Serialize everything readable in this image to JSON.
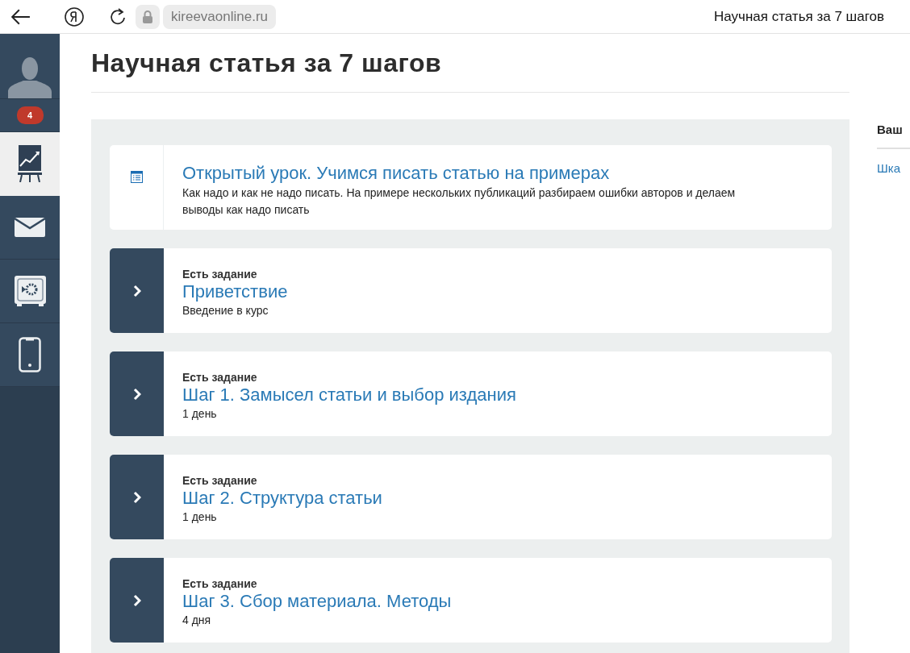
{
  "browser": {
    "address": "kireevaonline.ru",
    "tab_title": "Научная статья за 7 шагов"
  },
  "sidebar": {
    "badge": "4",
    "items": [
      {
        "kind": "chart",
        "selected": true
      },
      {
        "kind": "mail",
        "selected": false
      },
      {
        "kind": "safe",
        "selected": false
      },
      {
        "kind": "phone",
        "selected": false
      }
    ]
  },
  "page": {
    "title": "Научная статья за 7 шагов"
  },
  "lessons": [
    {
      "kind": "open",
      "title": "Открытый урок. Учимся писать статью на примерах",
      "description": "Как надо и как не надо писать. На примере нескольких публикаций разбираем ошибки авторов и делаем выводы как надо писать"
    },
    {
      "kind": "task",
      "task_label": "Есть задание",
      "title": "Приветствие",
      "description": "Введение в курс"
    },
    {
      "kind": "task",
      "task_label": "Есть задание",
      "title": "Шаг 1. Замысел статьи и выбор издания",
      "description": "1 день"
    },
    {
      "kind": "task",
      "task_label": "Есть задание",
      "title": "Шаг 2. Структура статьи",
      "description": "1 день"
    },
    {
      "kind": "task",
      "task_label": "Есть задание",
      "title": "Шаг 3. Сбор материала. Методы",
      "description": "4 дня"
    }
  ],
  "right_panel": {
    "heading": "Ваш",
    "link": "Шка"
  }
}
